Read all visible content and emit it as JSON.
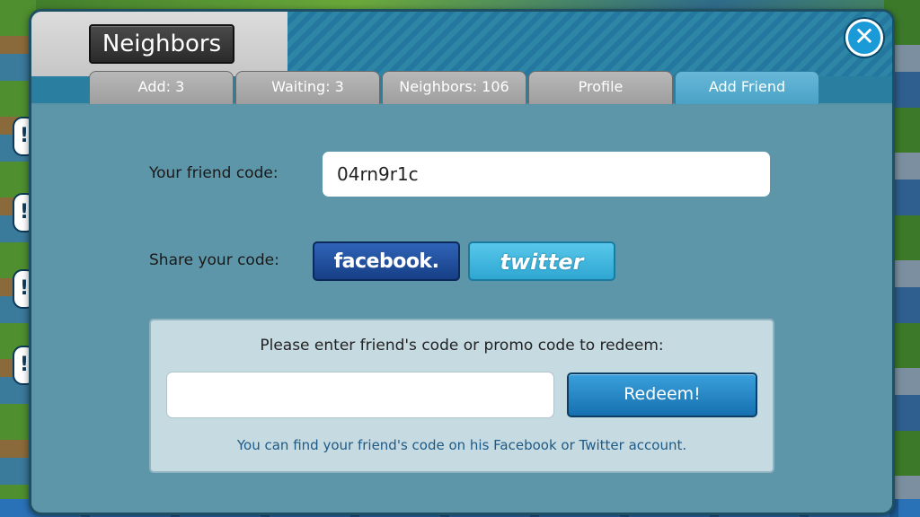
{
  "dialog": {
    "title": "Neighbors",
    "close_symbol": "✕",
    "close_icon": "close-icon"
  },
  "tabs": [
    {
      "label": "Add: 3",
      "active": false
    },
    {
      "label": "Waiting: 3",
      "active": false
    },
    {
      "label": "Neighbors: 106",
      "active": false
    },
    {
      "label": "Profile",
      "active": false
    },
    {
      "label": "Add Friend",
      "active": true
    }
  ],
  "friend_code": {
    "label": "Your friend code:",
    "value": "04rn9r1c"
  },
  "share": {
    "label": "Share your code:",
    "facebook_label": "facebook.",
    "twitter_label": "twitter"
  },
  "redeem": {
    "title": "Please enter friend's code or promo code to redeem:",
    "input_value": "",
    "button_label": "Redeem!",
    "hint": "You can find your friend's code on his Facebook or Twitter account."
  },
  "colors": {
    "panel": "#5d96a9",
    "active_tab": "#4aa2c6",
    "facebook": "#1e4a96",
    "twitter": "#3ab4de",
    "redeem_button": "#1c80c0"
  }
}
